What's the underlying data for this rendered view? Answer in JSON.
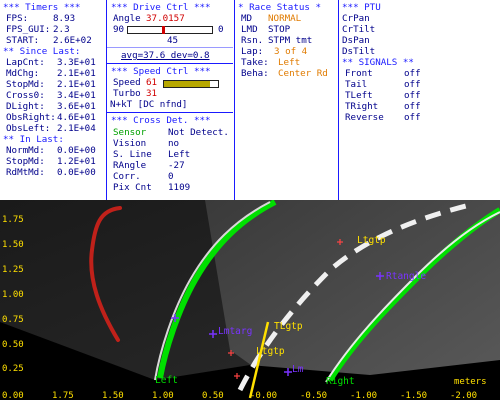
{
  "timers": {
    "header": "*** Timers ***",
    "fps_label": "FPS:",
    "fps_value": "8.93",
    "fps_gui_label": "FPS_GUI:",
    "fps_gui_value": "2.3",
    "start_label": "START:",
    "start_value": "2.6E+02",
    "since_header": "** Since Last:",
    "since": [
      {
        "label": "LapCnt:",
        "value": "3.3E+01"
      },
      {
        "label": "MdChg:",
        "value": "2.1E+01"
      },
      {
        "label": "StopMd:",
        "value": "2.1E+01"
      },
      {
        "label": "Cross0:",
        "value": "3.4E+01"
      },
      {
        "label": "DLight:",
        "value": "3.6E+01"
      },
      {
        "label": "ObsRight:",
        "value": "4.6E+01"
      },
      {
        "label": "ObsLeft:",
        "value": "2.1E+04"
      }
    ],
    "inlast_header": "** In Last:",
    "inlast": [
      {
        "label": "NormMd:",
        "value": "0.0E+00"
      },
      {
        "label": "StopMd:",
        "value": "1.2E+01"
      },
      {
        "label": "RdMtMd:",
        "value": "0.0E+00"
      }
    ]
  },
  "drive": {
    "header": "*** Drive Ctrl ***",
    "angle_label": "Angle",
    "angle_value": "37.0157",
    "slider_min": "90",
    "slider_max": "0",
    "slider_position": 0.41,
    "center_value": "45",
    "avg_dev": "avg=37.6  dev=0.8",
    "speed_header": "*** Speed Ctrl ***",
    "speed_label": "Speed",
    "speed_value": "61",
    "speed_fill": 0.85,
    "turbo_label": "Turbo",
    "turbo_value": "31",
    "nkt": "N+kT [DC nfnd]",
    "cross_header": "*** Cross Det. ***",
    "sensor_label": "Sensor",
    "sensor_value": "Not Detect.",
    "vision_label": "Vision",
    "vision_value": "no",
    "sline_label": "S. Line",
    "sline_value": "Left",
    "rangle_label": "RAngle",
    "rangle_value": "-27",
    "corr_label": "Corr.",
    "corr_value": "0",
    "pix_label": "Pix Cnt",
    "pix_value": "1109"
  },
  "race": {
    "header": "* Race Status *",
    "md_label": "MD",
    "md_value": "NORMAL",
    "lmd_label": "LMD",
    "lmd_value": "STOP",
    "rsn_label": "Rsn.",
    "rsn_value": "STPM tmt",
    "lap_label": "Lap:",
    "lap_value": "3 of 4",
    "take_label": "Take:",
    "take_value": "Left",
    "beha_label": "Beha:",
    "beha_value": "Center Rd"
  },
  "ptu": {
    "header": "*** PTU",
    "items": [
      "CrPan",
      "CrTilt",
      "DsPan",
      "DsTilt"
    ],
    "signals_header": "** SIGNALS **",
    "signals": [
      {
        "label": "Front",
        "value": "off"
      },
      {
        "label": "Tail",
        "value": "off"
      },
      {
        "label": "TLeft",
        "value": "off"
      },
      {
        "label": "TRight",
        "value": "off"
      },
      {
        "label": "Reverse",
        "value": "off"
      }
    ]
  },
  "camera": {
    "y_ticks": [
      "1.75",
      "1.50",
      "1.25",
      "1.00",
      "0.75",
      "0.50",
      "0.25"
    ],
    "x_ticks": [
      "0.00",
      "1.75",
      "1.50",
      "1.00",
      "0.50",
      "-0.00",
      "-0.50",
      "-1.00",
      "-1.50",
      "-2.00"
    ],
    "x_unit": "meters",
    "labels": {
      "ltgtp_top": "Ltgtp",
      "rtangle": "Rtangle",
      "ltgtp_mid": "Ltgtp",
      "tlgtp": "TLgtp",
      "ltgtp_low": "Ltgtp",
      "left": "Left",
      "right": "Right",
      "lm": "Lm",
      "lmtarg": "Lmtarg"
    },
    "colors": {
      "lane": "#00e000",
      "marker": "#7a33ff",
      "target": "#ffe000",
      "cross": "#ff4444"
    }
  }
}
